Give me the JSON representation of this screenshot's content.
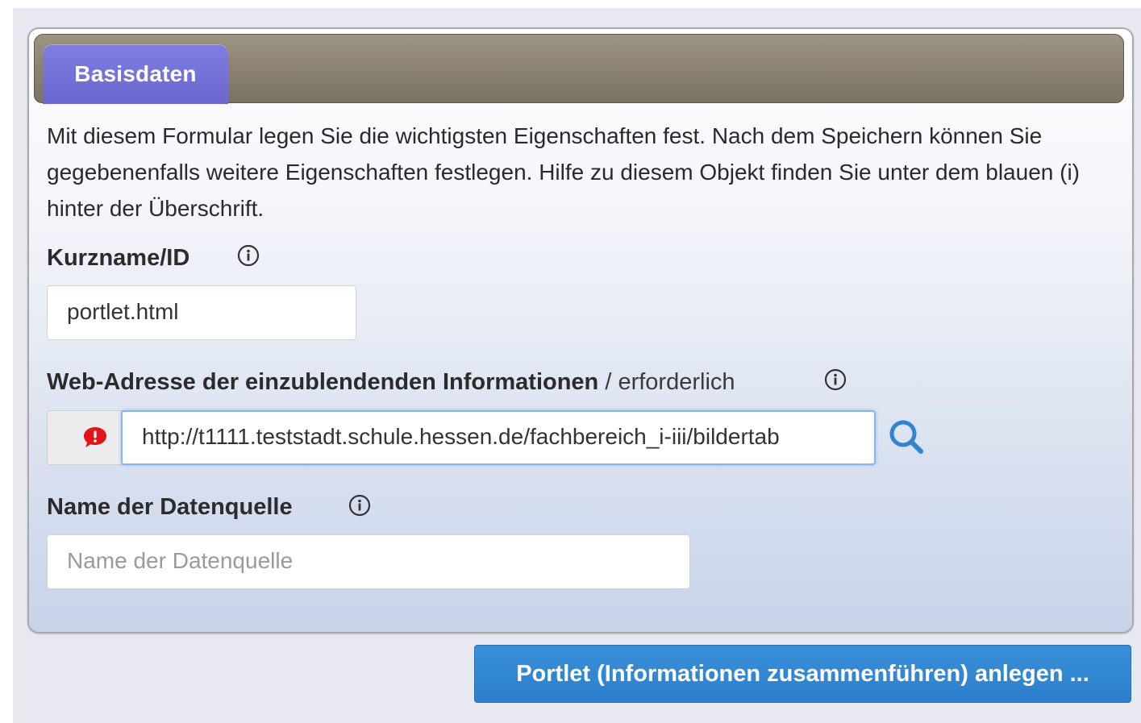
{
  "tabs": [
    {
      "label": "Basisdaten"
    }
  ],
  "intro_text": "Mit diesem Formular legen Sie die wichtigsten Eigenschaften fest. Nach dem Speichern können Sie gegebenenfalls weitere Eigenschaften festlegen. Hilfe zu diesem Objekt finden Sie unter dem blauen (i) hinter der Überschrift.",
  "fields": {
    "shortname": {
      "label": "Kurzname/ID",
      "value": "portlet.html",
      "info_icon": "info-icon"
    },
    "web_address": {
      "label": "Web-Adresse der einzublendenden Informationen",
      "required_text": " / erforderlich",
      "value": "http://t1111.teststadt.schule.hessen.de/fachbereich_i-iii/bildertab",
      "info_icon": "info-icon",
      "addon_icon": "alert-speech-bubble-icon",
      "action_icon": "search-icon"
    },
    "datasource_name": {
      "label": "Name der Datenquelle",
      "placeholder": "Name der Datenquelle",
      "value": "",
      "info_icon": "info-icon"
    }
  },
  "submit_label": "Portlet (Informationen zusammenführen) anlegen ...",
  "colors": {
    "tab_active": "#6d6ad3",
    "tabbar": "#8d8572",
    "submit_button": "#2f84d0",
    "alert": "#e3131b",
    "search_icon": "#2f84d0"
  }
}
